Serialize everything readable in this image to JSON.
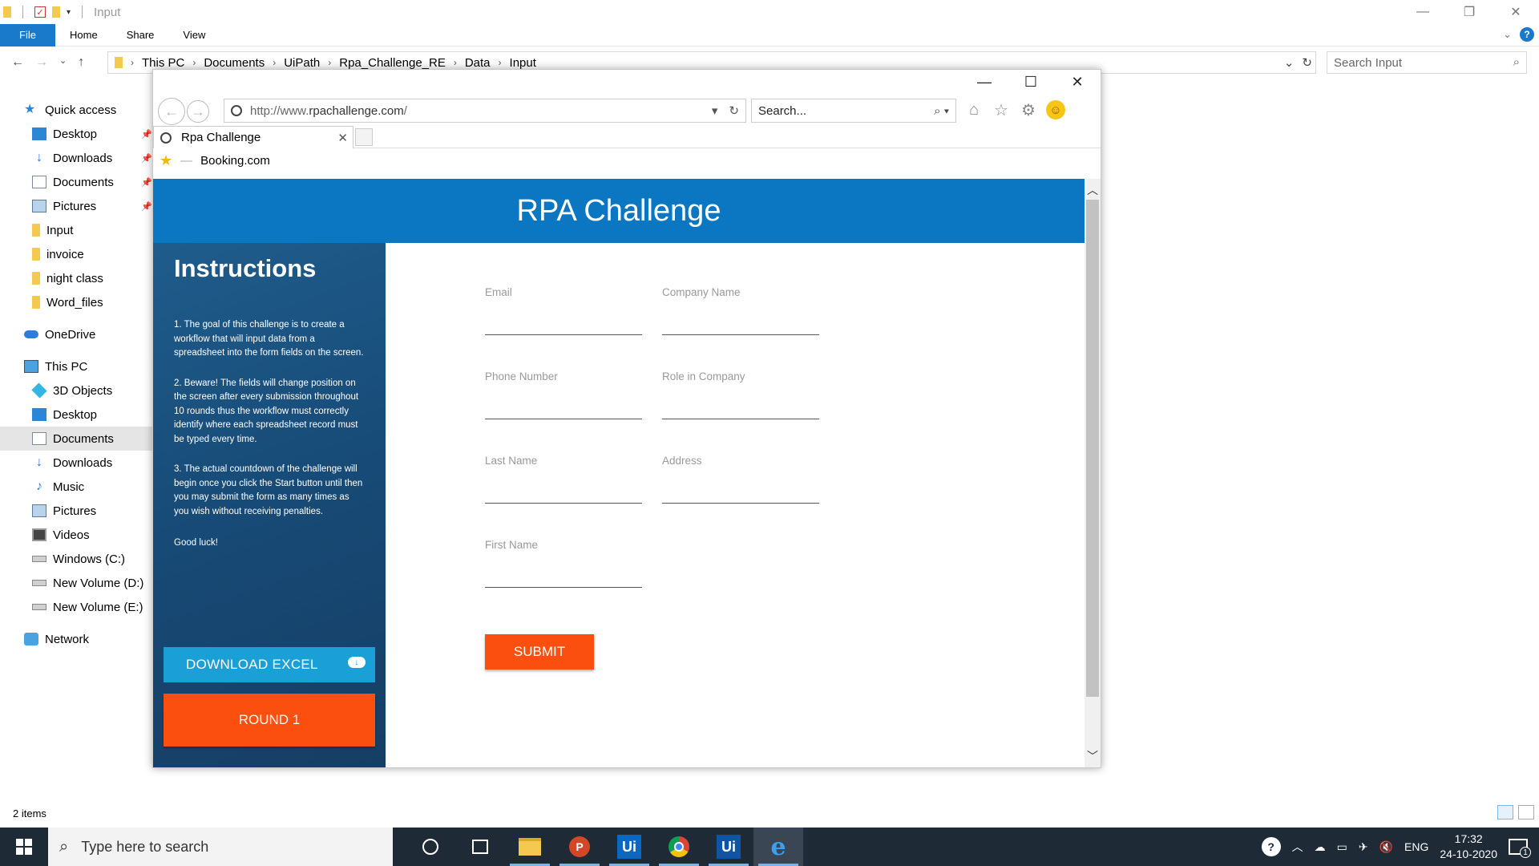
{
  "explorer": {
    "title": "Input",
    "ribbon_tabs": [
      "File",
      "Home",
      "Share",
      "View"
    ],
    "breadcrumb": [
      "This PC",
      "Documents",
      "UiPath",
      "Rpa_Challenge_RE",
      "Data",
      "Input"
    ],
    "search_placeholder": "Search Input",
    "sidebar": {
      "quick_access": "Quick access",
      "quick_items": [
        "Desktop",
        "Downloads",
        "Documents",
        "Pictures",
        "Input",
        "invoice",
        "night class",
        "Word_files"
      ],
      "onedrive": "OneDrive",
      "this_pc": "This PC",
      "pc_items": [
        "3D Objects",
        "Desktop",
        "Documents",
        "Downloads",
        "Music",
        "Pictures",
        "Videos",
        "Windows (C:)",
        "New Volume (D:)",
        "New Volume (E:)"
      ],
      "network": "Network"
    },
    "status": "2 items"
  },
  "browser": {
    "url_prefix": "http://www.",
    "url_domain": "rpachallenge.com",
    "url_suffix": "/",
    "search_placeholder": "Search...",
    "tab_title": "Rpa Challenge",
    "favorite": "Booking.com"
  },
  "page": {
    "header": "RPA Challenge",
    "instructions_title": "Instructions",
    "instructions": [
      "1. The goal of this challenge is to create a workflow that will input data from a spreadsheet into the form fields on the screen.",
      "2. Beware! The fields will change position on the screen after every submission throughout 10 rounds thus the workflow must correctly identify where each spreadsheet record must be typed every time.",
      "3. The actual countdown of the challenge will begin once you click the Start button until then you may submit the form as many times as you wish without receiving penalties."
    ],
    "good_luck": "Good luck!",
    "download_button": "DOWNLOAD EXCEL",
    "round_button": "ROUND 1",
    "fields": {
      "email": "Email",
      "company": "Company Name",
      "phone": "Phone Number",
      "role": "Role in Company",
      "last_name": "Last Name",
      "address": "Address",
      "first_name": "First Name"
    },
    "submit": "SUBMIT"
  },
  "taskbar": {
    "search_placeholder": "Type here to search",
    "apps": [
      "cortana-icon",
      "task-view-icon",
      "file-explorer-icon",
      "powerpoint-icon",
      "uipath-studio-icon",
      "chrome-icon",
      "uipath-robot-icon",
      "internet-explorer-icon"
    ],
    "language": "ENG",
    "time": "17:32",
    "date": "24-10-2020",
    "notifications": "1"
  },
  "colors": {
    "header_blue": "#0b77c3",
    "accent_orange": "#fa4f0e",
    "excel_blue": "#1a9fd6"
  }
}
